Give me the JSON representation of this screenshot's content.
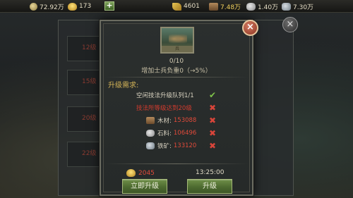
{
  "topbar": {
    "coins": "72.92万",
    "ingots": "173",
    "add": "+",
    "food": "4601",
    "wood": "7.48万",
    "stone": "1.40万",
    "iron": "7.30万"
  },
  "background": {
    "rows": [
      "12级",
      "15级",
      "20级",
      "22级"
    ],
    "close": "×"
  },
  "dialog": {
    "portrait_caption": "兵",
    "progress": "0/10",
    "bonus": "增加士兵负重0（→5%）",
    "requirements_title": "升级需求:",
    "requirements": [
      {
        "label": "空闲技法升级队列1/1",
        "value": "",
        "met": true,
        "status_icon": "✔"
      },
      {
        "label": "技法所等级达到20级",
        "value": "",
        "met": false,
        "status_icon": "✖"
      },
      {
        "label": "木材:",
        "value": "153088",
        "met": false,
        "status_icon": "✖",
        "icon": "wood-icon"
      },
      {
        "label": "石料:",
        "value": "106496",
        "met": false,
        "status_icon": "✖",
        "icon": "stone-icon"
      },
      {
        "label": "铁矿:",
        "value": "133120",
        "met": false,
        "status_icon": "✖",
        "icon": "iron-icon"
      }
    ],
    "cost": "2045",
    "timer": "13:25:00",
    "instant_button": "立即升级",
    "upgrade_button": "升级",
    "close": "×"
  },
  "colors": {
    "accent_gold": "#d3b357",
    "danger_red": "#d23b2e",
    "ok_green": "#7ec24a",
    "button_green": "#5a7a38"
  }
}
